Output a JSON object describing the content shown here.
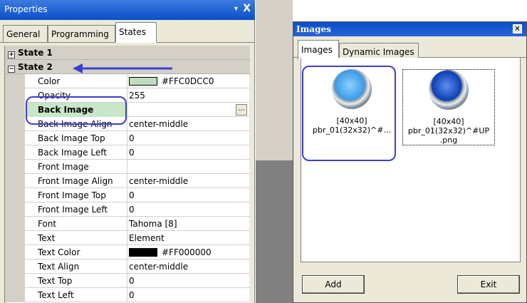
{
  "properties": {
    "title": "Properties",
    "pin_glyph": "▾",
    "close_glyph": "X",
    "tabs": [
      {
        "label": "General"
      },
      {
        "label": "Programming"
      },
      {
        "label": "States"
      }
    ],
    "sections": [
      {
        "toggle": "+",
        "label": "State 1"
      },
      {
        "toggle": "−",
        "label": "State 2"
      }
    ],
    "rows": [
      {
        "key": "Color",
        "value": "#FFC0DCC0",
        "swatch": "#c0dcc0"
      },
      {
        "key": "Opacity",
        "value": "255"
      },
      {
        "key": "Back Image",
        "value": ""
      },
      {
        "key": "Back Image Align",
        "value": "center-middle"
      },
      {
        "key": "Back Image Top",
        "value": "0"
      },
      {
        "key": "Back Image Left",
        "value": "0"
      },
      {
        "key": "Front Image",
        "value": ""
      },
      {
        "key": "Front Image Align",
        "value": "center-middle"
      },
      {
        "key": "Front Image Top",
        "value": "0"
      },
      {
        "key": "Front Image Left",
        "value": "0"
      },
      {
        "key": "Font",
        "value": "Tahoma [8]"
      },
      {
        "key": "Text",
        "value": "Element"
      },
      {
        "key": "Text Color",
        "value": "#FF000000",
        "swatch": "#000000"
      },
      {
        "key": "Text Align",
        "value": "center-middle"
      },
      {
        "key": "Text Top",
        "value": "0"
      },
      {
        "key": "Text Left",
        "value": "0"
      }
    ],
    "ellipsis": "..."
  },
  "dialog": {
    "title": "Images",
    "close_glyph": "×",
    "tabs": [
      {
        "label": "Images"
      },
      {
        "label": "Dynamic Images"
      }
    ],
    "images": [
      {
        "size": "[40x40]",
        "name": "pbr_01(32x32)^#...",
        "color": "light-blue"
      },
      {
        "size": "[40x40]",
        "name": "pbr_01(32x32)^#UP",
        "ext": ".png",
        "color": "dark-blue"
      }
    ],
    "buttons": {
      "add": "Add",
      "exit": "Exit"
    }
  },
  "colors": {
    "accent": "#3a3fcf",
    "highlight": "#c8e6c9"
  }
}
